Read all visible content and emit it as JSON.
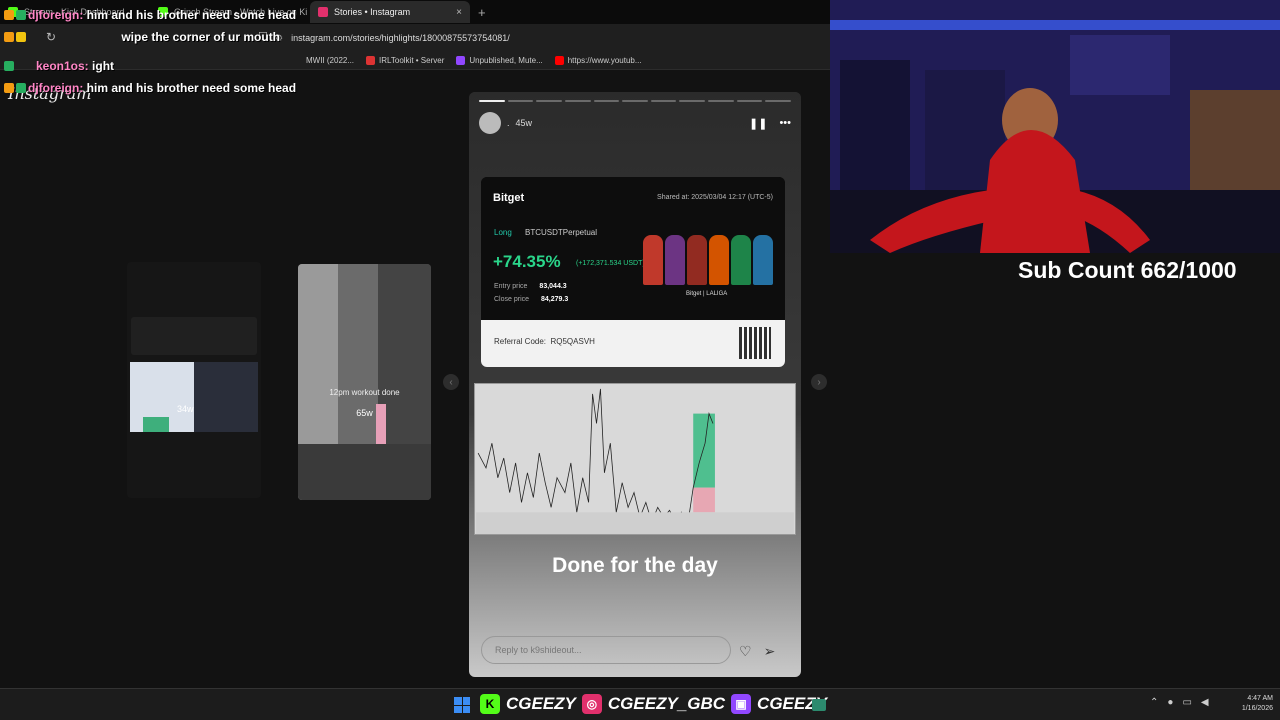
{
  "browser": {
    "tabs": [
      {
        "label": "Stream - Kick Dashboard",
        "color": "#53fc18",
        "active": false
      },
      {
        "label": "Grinch Stream - Watch Live on Ki",
        "color": "#53fc18",
        "active": false
      },
      {
        "label": "Stories • Instagram",
        "color": "#e1306c",
        "active": true
      }
    ],
    "tab_close": "×",
    "new_tab": "+",
    "url": "instagram.com/stories/highlights/18000875573754081/",
    "bookmarks": [
      {
        "label": "MWII (2022...",
        "color": "#888"
      },
      {
        "label": "IRLToolkit • Server",
        "color": "#d33"
      },
      {
        "label": "Unpublished, Mute...",
        "color": "#9147ff"
      },
      {
        "label": "https://www.youtub...",
        "color": "#f00"
      }
    ]
  },
  "instagram": {
    "logo": "Instagram",
    "side_labels": {
      "left": "34w",
      "right": "65w"
    },
    "right_caption": "12pm workout done",
    "story": {
      "time": "45w",
      "dot": ".",
      "pause_icon": "❚❚",
      "more_icon": "•••",
      "segments": 11,
      "card": {
        "brand": "Bitget",
        "shared": "Shared at: 2025/03/04 12:17 (UTC-5)",
        "side": "Long",
        "pair": "BTCUSDTPerpetual",
        "roi": "+74.35%",
        "roi_usd": "(+172,371.534 USDT)",
        "entry_label": "Entry price",
        "entry_value": "83,044.3",
        "close_label": "Close price",
        "close_value": "84,279.3",
        "co_brand": "Bitget | LALIGA",
        "referral_label": "Referral Code:",
        "referral_code": "RQ5QASVH"
      },
      "caption": "Done for the day",
      "reply_placeholder": "Reply to k9shideout...",
      "heart_icon": "♡",
      "send_icon": "➢"
    }
  },
  "overlay": {
    "sub_count": "Sub Count 662/1000",
    "chat": [
      {
        "name": "djforeign:",
        "text": "him and his brother need some head"
      },
      {
        "name": "",
        "text": "wipe the corner of ur mouth"
      },
      {
        "name": "keon1os:",
        "text": "ight"
      },
      {
        "name": "djforeign:",
        "text": "him and his brother need some head"
      }
    ]
  },
  "taskbar": {
    "handles": [
      "CGEEZY",
      "CGEEZY_GBC",
      "CGEEZY"
    ],
    "time": "4:47 AM",
    "date": "1/16/2026"
  },
  "colors": {
    "kick": "#53fc18",
    "instagram": "#e1306c",
    "twitch": "#9147ff",
    "chat_name": "#ff86c6"
  }
}
